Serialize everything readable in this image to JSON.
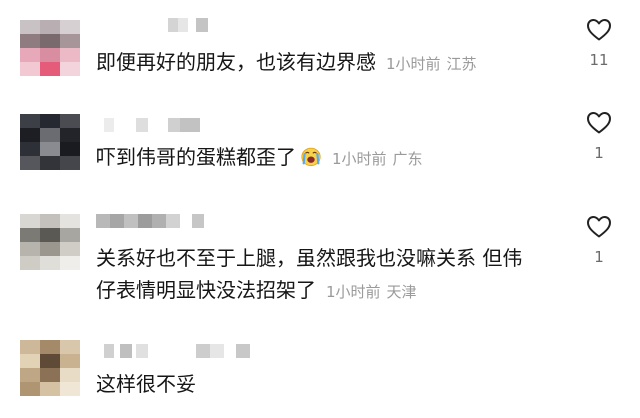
{
  "comments": [
    {
      "text": "即便再好的朋友，也该有边界感",
      "time": "1小时前",
      "location": "江苏",
      "likes": "11",
      "username": ""
    },
    {
      "text": "吓到伟哥的蛋糕都歪了",
      "emoji": "crying-face-icon",
      "time": "1小时前",
      "location": "广东",
      "likes": "1",
      "username": ""
    },
    {
      "text_line1": "关系好也不至于上腿，虽然跟我也没嘛关系 但伟",
      "text_line2": "仔表情明显快没法招架了",
      "time": "1小时前",
      "location": "天津",
      "likes": "1",
      "username": ""
    },
    {
      "text": "这样很不妥",
      "username": ""
    }
  ],
  "icons": {
    "like": "heart-outline-icon"
  },
  "colors": {
    "text": "#161616",
    "meta": "#9a9a9a",
    "count": "#6b6b6b"
  }
}
